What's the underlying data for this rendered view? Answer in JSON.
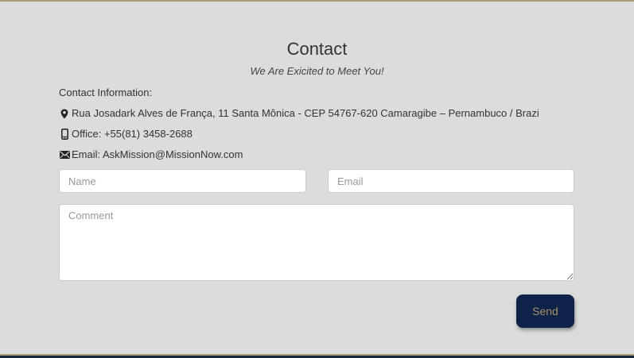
{
  "contact": {
    "title": "Contact",
    "subtitle": "We Are Exicited to Meet You!",
    "info_heading": "Contact Information:",
    "address": "Rua Josadark Alves de França, 11 Santa Mônica - CEP 54767-620 Camaragibe – Pernambuco / Brazi",
    "phone": "Office: +55(81) 3458-2688",
    "email": "Email: AskMission@MissionNow.com"
  },
  "form": {
    "name_placeholder": "Name",
    "email_placeholder": "Email",
    "comment_placeholder": "Comment",
    "send_label": "Send"
  },
  "icons": {
    "address": "map-marker-icon",
    "phone": "mobile-phone-icon",
    "email": "envelope-icon"
  },
  "colors": {
    "background": "#dadcdd",
    "button_bg": "#0f2248",
    "button_text": "#a59266",
    "accent_border": "#a89a78"
  }
}
